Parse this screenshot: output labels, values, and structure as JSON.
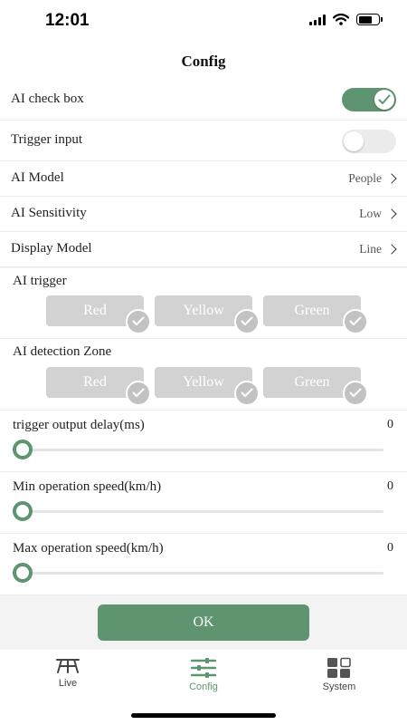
{
  "status_bar": {
    "time": "12:01"
  },
  "header": {
    "title": "Config"
  },
  "rows": {
    "ai_check_box": {
      "label": "AI check box",
      "toggle_on": true
    },
    "trigger_input": {
      "label": "Trigger input",
      "toggle_on": false
    },
    "ai_model": {
      "label": "AI Model",
      "value": "People"
    },
    "ai_sensitivity": {
      "label": "AI Sensitivity",
      "value": "Low"
    },
    "display_model": {
      "label": "Display Model",
      "value": "Line"
    }
  },
  "ai_trigger": {
    "label": "AI trigger",
    "options": [
      "Red",
      "Yellow",
      "Green"
    ]
  },
  "ai_detection_zone": {
    "label": "AI detection Zone",
    "options": [
      "Red",
      "Yellow",
      "Green"
    ]
  },
  "sliders": {
    "trigger_delay": {
      "label": "trigger output delay(ms)",
      "value": "0"
    },
    "min_speed": {
      "label": "Min operation speed(km/h)",
      "value": "0"
    },
    "max_speed": {
      "label": "Max operation speed(km/h)",
      "value": "0"
    }
  },
  "ok_button": {
    "label": "OK"
  },
  "tabs": [
    {
      "label": "Live",
      "icon": "live-icon",
      "active": false
    },
    {
      "label": "Config",
      "icon": "config-icon",
      "active": true
    },
    {
      "label": "System",
      "icon": "system-icon",
      "active": false
    }
  ],
  "colors": {
    "accent": "#5f9470",
    "chip": "#d2d2d2",
    "chip_check": "#c2c2c2"
  }
}
